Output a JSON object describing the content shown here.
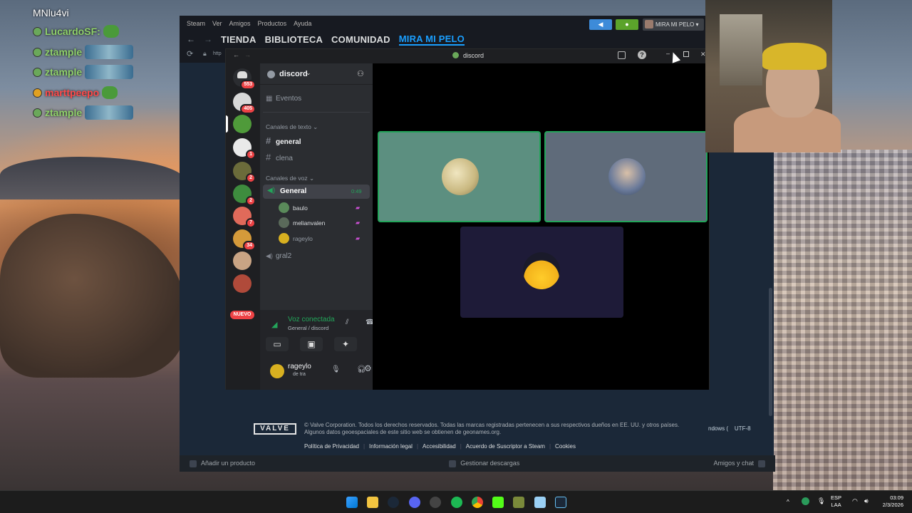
{
  "stream_chat": {
    "messages": [
      {
        "user": "MNlu4vi"
      },
      {
        "user": "LucardoSF:"
      },
      {
        "user": "ztample"
      },
      {
        "user": "ztample"
      },
      {
        "user": "marttpeepo"
      },
      {
        "user": "ztample"
      }
    ]
  },
  "steam": {
    "menu": [
      "Steam",
      "Ver",
      "Amigos",
      "Productos",
      "Ayuda"
    ],
    "nav": [
      "TIENDA",
      "BIBLIOTECA",
      "COMUNIDAD",
      "MIRA MI PELO"
    ],
    "account_name": "MIRA MI PELO",
    "url_fragment": "http",
    "footer": {
      "logo": "VALVE",
      "copyright_line1": "© Valve Corporation. Todos los derechos reservados. Todas las marcas registradas pertenecen a sus respectivos dueños en EE. UU. y otros países.",
      "copyright_line2": "Algunos datos geoespaciales de este sitio web se obtienen de geonames.org.",
      "links": [
        "Política de Privacidad",
        "Información legal",
        "Accesibilidad",
        "Acuerdo de Suscriptor a Steam",
        "Cookies"
      ]
    },
    "bottom_bar": {
      "add_product": "Añadir un producto",
      "manage_downloads": "Gestionar descargas",
      "friends_chat": "Amigos y chat"
    },
    "side_text": {
      "windows": "ndows (",
      "encoding": "UTF-8"
    }
  },
  "discord": {
    "window_title": "discord",
    "server_name": "discord",
    "guild_badges": [
      "553",
      "405",
      "1",
      "2",
      "2",
      "7",
      "34"
    ],
    "nuevo_label": "NUEVO",
    "events_label": "Eventos",
    "text_category": "Canales de texto",
    "text_channels": [
      "general",
      "clena"
    ],
    "voice_category": "Canales de voz",
    "voice_channels": [
      {
        "name": "General",
        "timer": "0:49"
      },
      {
        "name": "gral2"
      }
    ],
    "voice_users": [
      "baulo",
      "melianvalen",
      "rageylo"
    ],
    "voice_panel": {
      "status": "Voz conectada",
      "channel": "General / discord"
    },
    "user": {
      "name": "rageylo",
      "status": "de tra"
    }
  },
  "taskbar": {
    "lang": "ESP",
    "layout": "LAA",
    "time": "03:09",
    "date": "2/3/2026"
  }
}
